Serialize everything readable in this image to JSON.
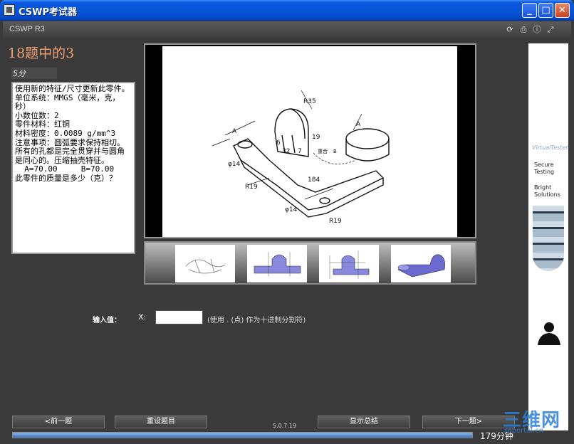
{
  "window": {
    "title": "CSWP考试器",
    "minimize": "_",
    "maximize": "□",
    "close": "✕"
  },
  "header": {
    "brand": "CSWP R3",
    "icons": [
      "refresh-icon",
      "print-icon",
      "info-icon",
      "fullscreen-icon"
    ]
  },
  "question": {
    "title": "18题中的3",
    "points": "5分",
    "text": "使用新的特征/尺寸更新此零件。\n单位系统：MMGS（毫米，克，秒）\n小数位数：2\n零件材料：红铜\n材料密度：0.0089 g/mm^3\n注意事项：圆弧要求保持相切。所有的孔都是完全贯穿并与圆角是同心的。压缩抽壳特征。\n  A=70.00     B=70.00\n此零件的质量是多少（克）？"
  },
  "drawing": {
    "labels": [
      "R35",
      "A",
      "19",
      "6",
      "32",
      "7",
      "重合",
      "B",
      "φ14",
      "R19",
      "184",
      "φ14",
      "R19",
      "A"
    ]
  },
  "thumbnails": [
    "thumbnail-1",
    "thumbnail-2",
    "thumbnail-3",
    "thumbnail-4"
  ],
  "answer": {
    "label": "输入值：",
    "axis": "X:",
    "value": "",
    "hint": "(使用 . (点) 作为十进制分割符)"
  },
  "sidebar": {
    "logo": "VirtualTester",
    "line1": "Secure\nTesting",
    "line2": "Bright\nSolutions"
  },
  "footer": {
    "prev": "<前一题",
    "reset": "重设题目",
    "version": "5.0.7.19",
    "summary": "显示总结",
    "next": "下一题>",
    "timer": "179分钟",
    "progress": 1.0
  },
  "watermark": {
    "main": "三维网",
    "sub": "3dportal.cn"
  },
  "colors": {
    "accent": "#f0a070",
    "progress": "#3a6fb8"
  }
}
